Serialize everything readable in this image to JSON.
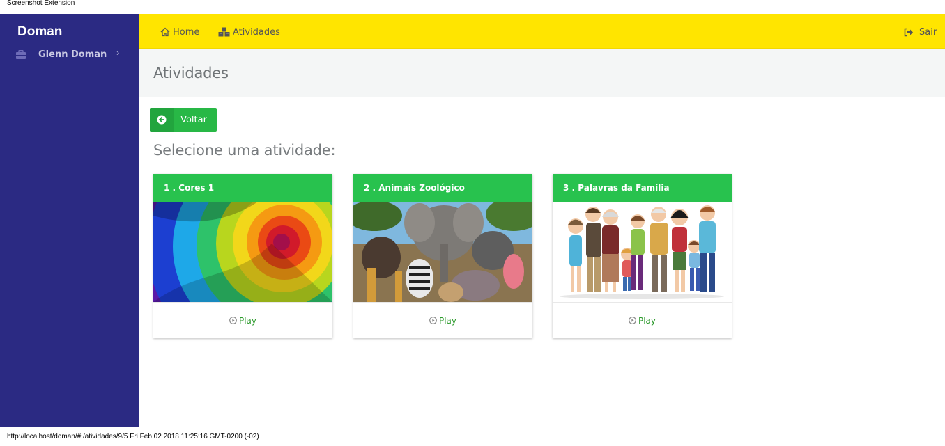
{
  "extension_label": "Screenshot Extension",
  "sidebar": {
    "brand": "Doman",
    "user": {
      "name": "Glenn Doman",
      "icon": "briefcase-icon"
    }
  },
  "topnav": {
    "home_label": "Home",
    "activities_label": "Atividades",
    "logout_label": "Sair"
  },
  "page": {
    "title": "Atividades",
    "back_label": "Voltar",
    "subtitle": "Selecione uma atividade:"
  },
  "activities": [
    {
      "title": "1 . Cores 1",
      "play_label": "Play",
      "image": "rainbow-swirl-image"
    },
    {
      "title": "2 . Animais Zoológico",
      "play_label": "Play",
      "image": "zoo-animals-image"
    },
    {
      "title": "3 . Palavras da Família",
      "play_label": "Play",
      "image": "family-illustration-image"
    }
  ],
  "status_bar": "http://localhost/doman/#!/atividades/9/5 Fri Feb 02 2018 11:25:16 GMT-0200 (-02)",
  "colors": {
    "sidebar": "#2b2a83",
    "topbar": "#ffe500",
    "accent_green": "#28c24e",
    "play_green": "#2c9a2c"
  }
}
